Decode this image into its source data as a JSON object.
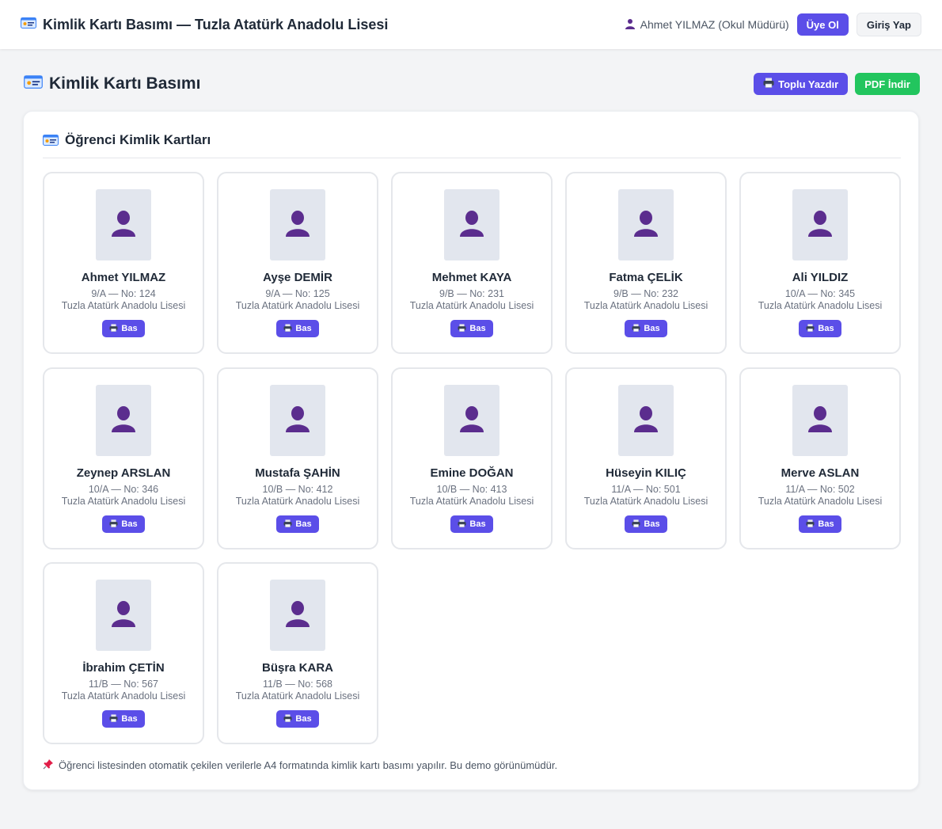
{
  "header": {
    "title": "Kimlik Kartı Basımı — Tuzla Atatürk Anadolu Lisesi",
    "user": "Ahmet YILMAZ (Okul Müdürü)",
    "signup_label": "Üye Ol",
    "login_label": "Giriş Yap"
  },
  "page": {
    "title": "Kimlik Kartı Basımı",
    "print_all_label": "Toplu Yazdır",
    "pdf_label": "PDF İndir"
  },
  "panel": {
    "title": "Öğrenci Kimlik Kartları",
    "footnote": "Öğrenci listesinden otomatik çekilen verilerle A4 formatında kimlik kartı basımı yapılır. Bu demo görünümüdür."
  },
  "cards": [
    {
      "name": "Ahmet YILMAZ",
      "meta": "9/A — No: 124",
      "school": "Tuzla Atatürk Anadolu Lisesi",
      "button": "Bas"
    },
    {
      "name": "Ayşe DEMİR",
      "meta": "9/A — No: 125",
      "school": "Tuzla Atatürk Anadolu Lisesi",
      "button": "Bas"
    },
    {
      "name": "Mehmet KAYA",
      "meta": "9/B — No: 231",
      "school": "Tuzla Atatürk Anadolu Lisesi",
      "button": "Bas"
    },
    {
      "name": "Fatma ÇELİK",
      "meta": "9/B — No: 232",
      "school": "Tuzla Atatürk Anadolu Lisesi",
      "button": "Bas"
    },
    {
      "name": "Ali YILDIZ",
      "meta": "10/A — No: 345",
      "school": "Tuzla Atatürk Anadolu Lisesi",
      "button": "Bas"
    },
    {
      "name": "Zeynep ARSLAN",
      "meta": "10/A — No: 346",
      "school": "Tuzla Atatürk Anadolu Lisesi",
      "button": "Bas"
    },
    {
      "name": "Mustafa ŞAHİN",
      "meta": "10/B — No: 412",
      "school": "Tuzla Atatürk Anadolu Lisesi",
      "button": "Bas"
    },
    {
      "name": "Emine DOĞAN",
      "meta": "10/B — No: 413",
      "school": "Tuzla Atatürk Anadolu Lisesi",
      "button": "Bas"
    },
    {
      "name": "Hüseyin KILIÇ",
      "meta": "11/A — No: 501",
      "school": "Tuzla Atatürk Anadolu Lisesi",
      "button": "Bas"
    },
    {
      "name": "Merve ASLAN",
      "meta": "11/A — No: 502",
      "school": "Tuzla Atatürk Anadolu Lisesi",
      "button": "Bas"
    },
    {
      "name": "İbrahim ÇETİN",
      "meta": "11/B — No: 567",
      "school": "Tuzla Atatürk Anadolu Lisesi",
      "button": "Bas"
    },
    {
      "name": "Büşra KARA",
      "meta": "11/B — No: 568",
      "school": "Tuzla Atatürk Anadolu Lisesi",
      "button": "Bas"
    }
  ],
  "icons": {
    "id_card": "id-card-icon",
    "user": "user-icon",
    "printer": "printer-icon",
    "pin": "pushpin-icon"
  },
  "colors": {
    "accent": "#5b4ee8",
    "success": "#22c55e",
    "avatar": "#5b2d8e",
    "photo_bg": "#e2e6ee"
  }
}
